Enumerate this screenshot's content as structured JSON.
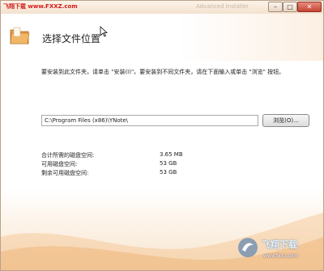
{
  "window": {
    "watermark_top": "飞翔下载 www.FXXZ.com",
    "title_right": "Advanced Installer",
    "controls": {
      "minimize": "–",
      "maximize": "□",
      "close": "✕"
    }
  },
  "header": {
    "title": "选择文件位置"
  },
  "instructions": "要安装到此文件夹，请单击 \"安装(I)\"。要安装到不同文件夹，请在下面输入或单击 \"浏览\" 按钮。",
  "install_path": {
    "value": "C:\\Program Files (x86)\\YNote\\"
  },
  "browse_button": "浏览(O)...",
  "disk_space": [
    {
      "label": "合计所需的磁盘空间:",
      "value": "3.65 MB"
    },
    {
      "label": "可用磁盘空间:",
      "value": "53 GB"
    },
    {
      "label": "剩余可用磁盘空间:",
      "value": "53 GB"
    }
  ],
  "watermark_bottom": {
    "text": "飞翔下载",
    "url": "www.fxxz.com"
  },
  "icons": [
    "folder-icon",
    "cursor-icon",
    "minimize-icon",
    "maximize-icon",
    "close-icon"
  ]
}
